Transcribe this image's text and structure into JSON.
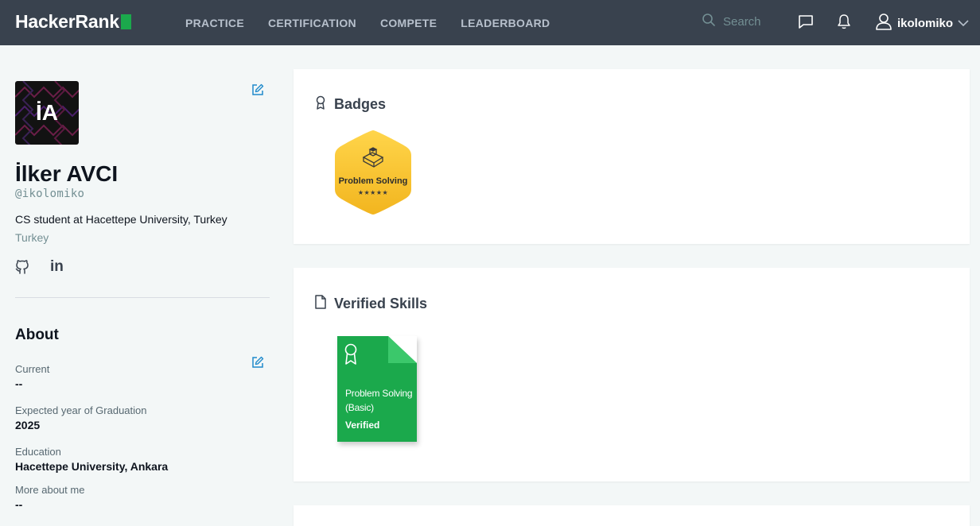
{
  "nav": {
    "logo_text": "HackerRank",
    "links": [
      "PRACTICE",
      "CERTIFICATION",
      "COMPETE",
      "LEADERBOARD"
    ],
    "search_placeholder": "Search",
    "username": "ikolomiko",
    "bg_color": "#39424e",
    "accent_color": "#1ba94c"
  },
  "profile": {
    "avatar_initials": "İA",
    "name": "İlker AVCI",
    "handle": "@ikolomiko",
    "bio": "CS student at Hacettepe University, Turkey",
    "country": "Turkey",
    "socials": [
      "github-icon",
      "linkedin-icon"
    ],
    "linkedin_text": "in"
  },
  "about": {
    "title": "About",
    "fields": [
      {
        "label": "Current",
        "value": "--"
      },
      {
        "label": "Expected year of Graduation",
        "value": "2025"
      },
      {
        "label": "Education",
        "value": "Hacettepe University, Ankara"
      },
      {
        "label": "More about me",
        "value": "--"
      }
    ]
  },
  "badges": {
    "title": "Badges",
    "items": [
      {
        "label": "Problem Solving",
        "stars": "★★★★★",
        "star_count": 5,
        "color": "#f5c431"
      }
    ]
  },
  "verified_skills": {
    "title": "Verified Skills",
    "items": [
      {
        "title": "Problem Solving (Basic)",
        "status": "Verified",
        "color": "#1ba94c"
      }
    ]
  }
}
